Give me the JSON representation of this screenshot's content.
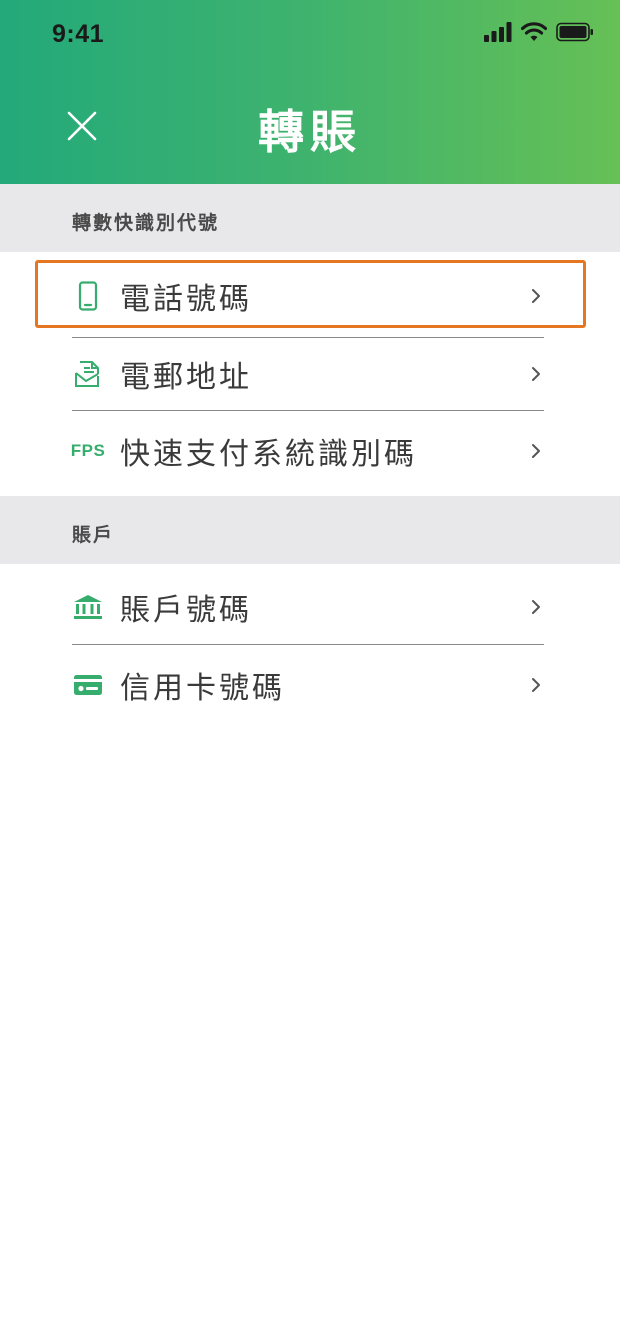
{
  "status": {
    "time": "9:41"
  },
  "header": {
    "title": "轉賬",
    "close_icon": "close-icon"
  },
  "sections": [
    {
      "title": "轉數快識別代號",
      "items": [
        {
          "label": "電話號碼",
          "icon": "phone-icon"
        },
        {
          "label": "電郵地址",
          "icon": "email-icon"
        },
        {
          "label": "快速支付系統識別碼",
          "icon": "fps-icon",
          "icon_text": "FPS"
        }
      ]
    },
    {
      "title": "賬戶",
      "items": [
        {
          "label": "賬戶號碼",
          "icon": "bank-icon"
        },
        {
          "label": "信用卡號碼",
          "icon": "credit-card-icon"
        }
      ]
    }
  ],
  "colors": {
    "accent": "#36ad6d",
    "header_start": "#23a97a",
    "header_end": "#66c055",
    "highlight": "#e57722",
    "section_bg": "#e8e8ea"
  }
}
